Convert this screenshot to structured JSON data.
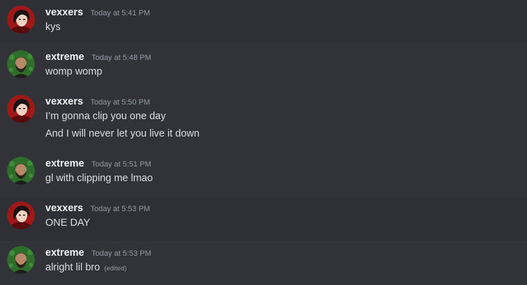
{
  "messages": [
    {
      "author": "vexxers",
      "time": "Today at 5:41 PM",
      "lines": [
        "kys"
      ],
      "avatar": "vexxers-avatar"
    },
    {
      "author": "extreme",
      "time": "Today at 5:48 PM",
      "lines": [
        "womp womp"
      ],
      "avatar": "extreme-avatar"
    },
    {
      "author": "vexxers",
      "time": "Today at 5:50 PM",
      "lines": [
        "I’m gonna clip you one day",
        "And I will never let you live it down"
      ],
      "avatar": "vexxers-avatar"
    },
    {
      "author": "extreme",
      "time": "Today at 5:51 PM",
      "lines": [
        "gl with clipping me lmao"
      ],
      "avatar": "extreme-avatar"
    },
    {
      "author": "vexxers",
      "time": "Today at 5:53 PM",
      "lines": [
        "ONE DAY"
      ],
      "avatar": "vexxers-avatar"
    },
    {
      "author": "extreme",
      "time": "Today at 5:53 PM",
      "lines": [
        "alright lil bro"
      ],
      "edited": "(edited)",
      "avatar": "extreme-avatar"
    }
  ],
  "colors": {
    "background": "#313338",
    "username": "#f2f3f5",
    "message_text": "#dbdee1",
    "timestamp": "#949ba4"
  }
}
